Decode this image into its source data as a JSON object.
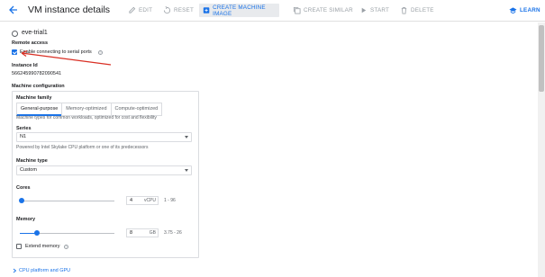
{
  "header": {
    "title": "VM instance details",
    "toolbar": {
      "edit": "EDIT",
      "reset": "RESET",
      "create_image": "CREATE MACHINE IMAGE",
      "create_similar": "CREATE SIMILAR",
      "start": "START",
      "delete": "DELETE",
      "learn": "LEARN"
    }
  },
  "instance": {
    "name": "eve-trial1"
  },
  "remote_access": {
    "label": "Remote access",
    "serial_ports_label": "Enable connecting to serial ports",
    "serial_ports_checked": true
  },
  "instance_id": {
    "label": "Instance Id",
    "value": "5662459907820905​41"
  },
  "machine_config": {
    "heading": "Machine configuration",
    "family_label": "Machine family",
    "tabs": [
      "General-purpose",
      "Memory-optimized",
      "Compute-optimized"
    ],
    "family_hint": "Machine types for common workloads, optimized for cost and flexibility",
    "series_label": "Series",
    "series_value": "N1",
    "series_hint": "Powered by Intel Skylake CPU platform or one of its predecessors",
    "type_label": "Machine type",
    "type_value": "Custom",
    "cores_label": "Cores",
    "cores_value": "4",
    "cores_unit": "vCPU",
    "cores_range": "1 - 96",
    "memory_label": "Memory",
    "memory_value": "8",
    "memory_unit": "GB",
    "memory_range": "3.75 - 26",
    "extend_memory_label": "Extend memory"
  },
  "cpu_platform_link": "CPU platform and GPU",
  "colors": {
    "accent": "#1a73e8",
    "annotation_arrow": "#d93025"
  }
}
